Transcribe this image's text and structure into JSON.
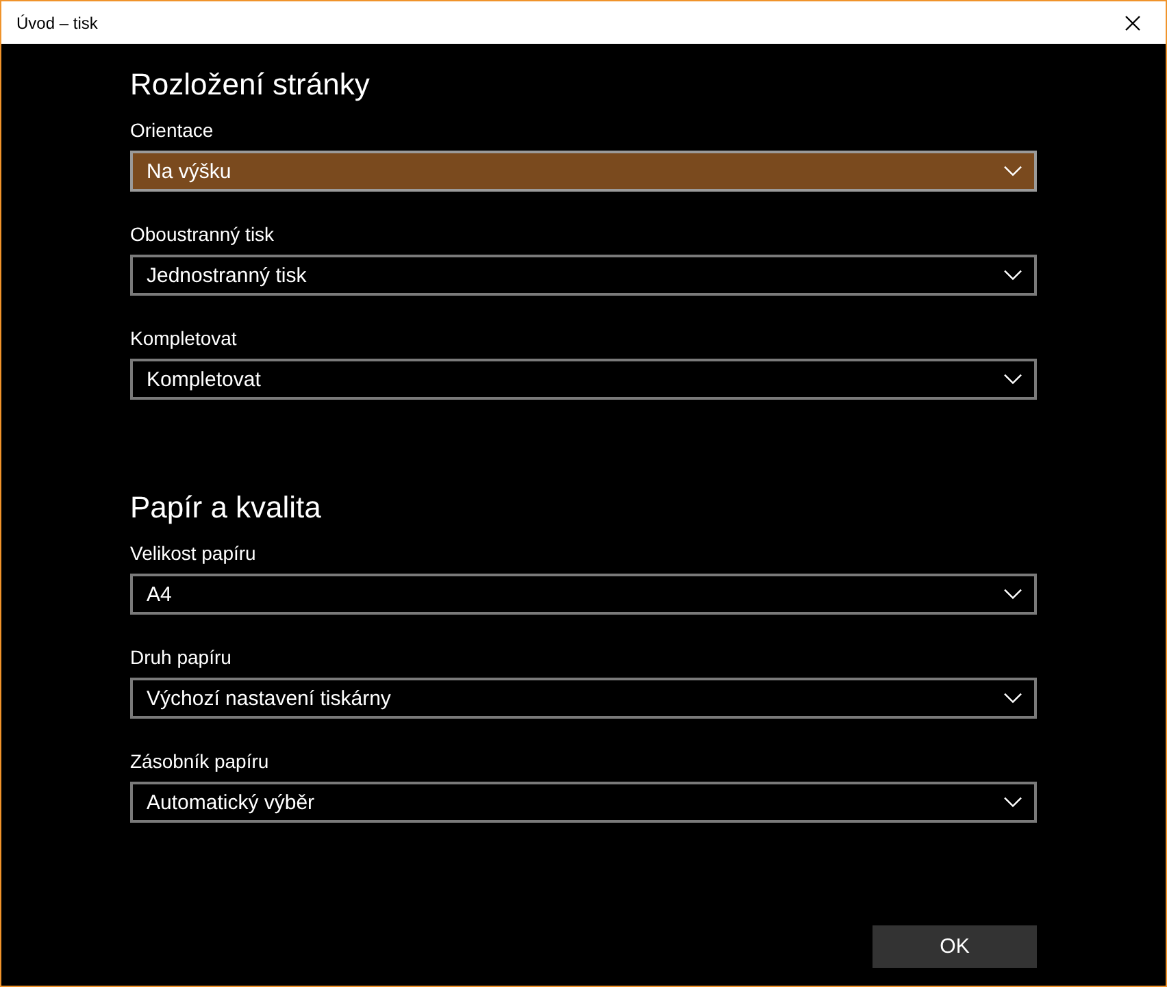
{
  "window": {
    "title": "Úvod – tisk"
  },
  "sections": [
    {
      "heading": "Rozložení stránky",
      "fields": [
        {
          "label": "Orientace",
          "value": "Na výšku",
          "selected": true
        },
        {
          "label": "Oboustranný tisk",
          "value": "Jednostranný tisk",
          "selected": false
        },
        {
          "label": "Kompletovat",
          "value": "Kompletovat",
          "selected": false
        }
      ]
    },
    {
      "heading": "Papír a kvalita",
      "fields": [
        {
          "label": "Velikost papíru",
          "value": "A4",
          "selected": false
        },
        {
          "label": "Druh papíru",
          "value": "Výchozí nastavení tiskárny",
          "selected": false
        },
        {
          "label": "Zásobník papíru",
          "value": "Automatický výběr",
          "selected": false
        }
      ]
    }
  ],
  "buttons": [
    "OK"
  ]
}
